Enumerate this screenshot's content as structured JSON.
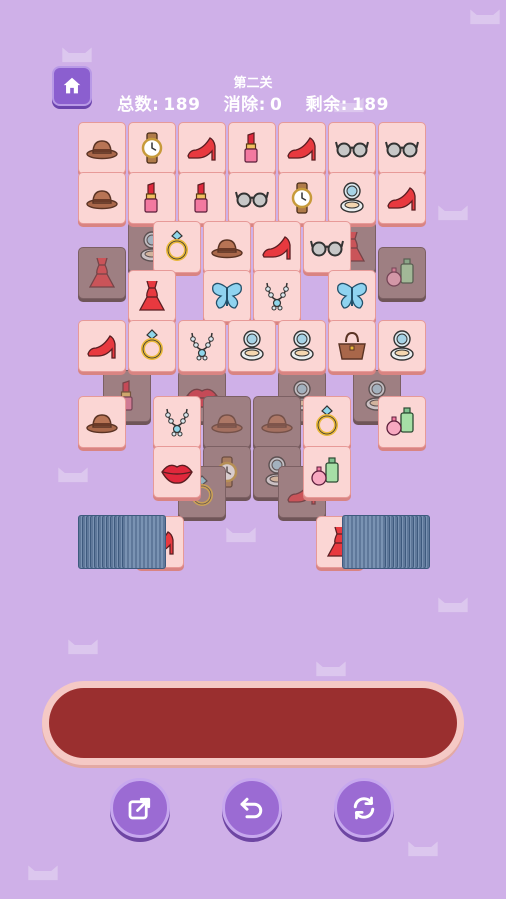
{
  "header": {
    "level_title": "第二关",
    "total_label": "总数:",
    "total_value": "189",
    "cleared_label": "消除:",
    "cleared_value": "0",
    "remaining_label": "剩余:",
    "remaining_value": "189"
  },
  "colors": {
    "background": "#cfb0e8",
    "tile_face": "#fbd6d4",
    "tile_dimmed": "#9e7f82",
    "slot_bar_inner": "#9a2f2f",
    "button_purple": "#9b6bd3"
  },
  "buttons": {
    "home": "home-icon",
    "move_out": "move-out-icon",
    "undo": "undo-icon",
    "shuffle": "shuffle-icon"
  },
  "tiles": [
    {
      "icon": "hat",
      "dim": false
    },
    {
      "icon": "watch",
      "dim": false
    },
    {
      "icon": "heel",
      "dim": false
    },
    {
      "icon": "lipstick",
      "dim": false
    },
    {
      "icon": "heel",
      "dim": false
    },
    {
      "icon": "glasses",
      "dim": false
    },
    {
      "icon": "glasses",
      "dim": false
    },
    {
      "icon": "hat",
      "dim": false
    },
    {
      "icon": "lipstick",
      "dim": false
    },
    {
      "icon": "lipstick",
      "dim": false
    },
    {
      "icon": "glasses",
      "dim": false
    },
    {
      "icon": "watch",
      "dim": false
    },
    {
      "icon": "compact",
      "dim": false
    },
    {
      "icon": "heel",
      "dim": false
    },
    {
      "icon": "ring",
      "dim": false
    },
    {
      "icon": "hat",
      "dim": false
    },
    {
      "icon": "heel",
      "dim": false
    },
    {
      "icon": "glasses",
      "dim": false
    },
    {
      "icon": "dress",
      "dim": false
    },
    {
      "icon": "butterfly",
      "dim": false
    },
    {
      "icon": "necklace",
      "dim": false
    },
    {
      "icon": "butterfly",
      "dim": false
    },
    {
      "icon": "heel",
      "dim": false
    },
    {
      "icon": "ring",
      "dim": false
    },
    {
      "icon": "necklace",
      "dim": false
    },
    {
      "icon": "compact",
      "dim": false
    },
    {
      "icon": "compact",
      "dim": false
    },
    {
      "icon": "handbag",
      "dim": false
    },
    {
      "icon": "compact",
      "dim": false
    },
    {
      "icon": "hat",
      "dim": false
    },
    {
      "icon": "necklace",
      "dim": false
    },
    {
      "icon": "ring",
      "dim": false
    },
    {
      "icon": "perfume",
      "dim": false
    },
    {
      "icon": "lips",
      "dim": false
    },
    {
      "icon": "perfume",
      "dim": false
    },
    {
      "icon": "heel",
      "dim": false
    },
    {
      "icon": "dress",
      "dim": false
    },
    {
      "icon": "dress",
      "dim": true
    },
    {
      "icon": "compact",
      "dim": true
    },
    {
      "icon": "dress",
      "dim": true
    },
    {
      "icon": "perfume",
      "dim": true
    },
    {
      "icon": "lipstick",
      "dim": true
    },
    {
      "icon": "lips",
      "dim": true
    },
    {
      "icon": "compact",
      "dim": true
    },
    {
      "icon": "compact",
      "dim": true
    },
    {
      "icon": "hat",
      "dim": true
    },
    {
      "icon": "hat",
      "dim": true
    },
    {
      "icon": "watch",
      "dim": true
    },
    {
      "icon": "compact",
      "dim": true
    },
    {
      "icon": "ring",
      "dim": true
    },
    {
      "icon": "heel",
      "dim": true
    }
  ]
}
